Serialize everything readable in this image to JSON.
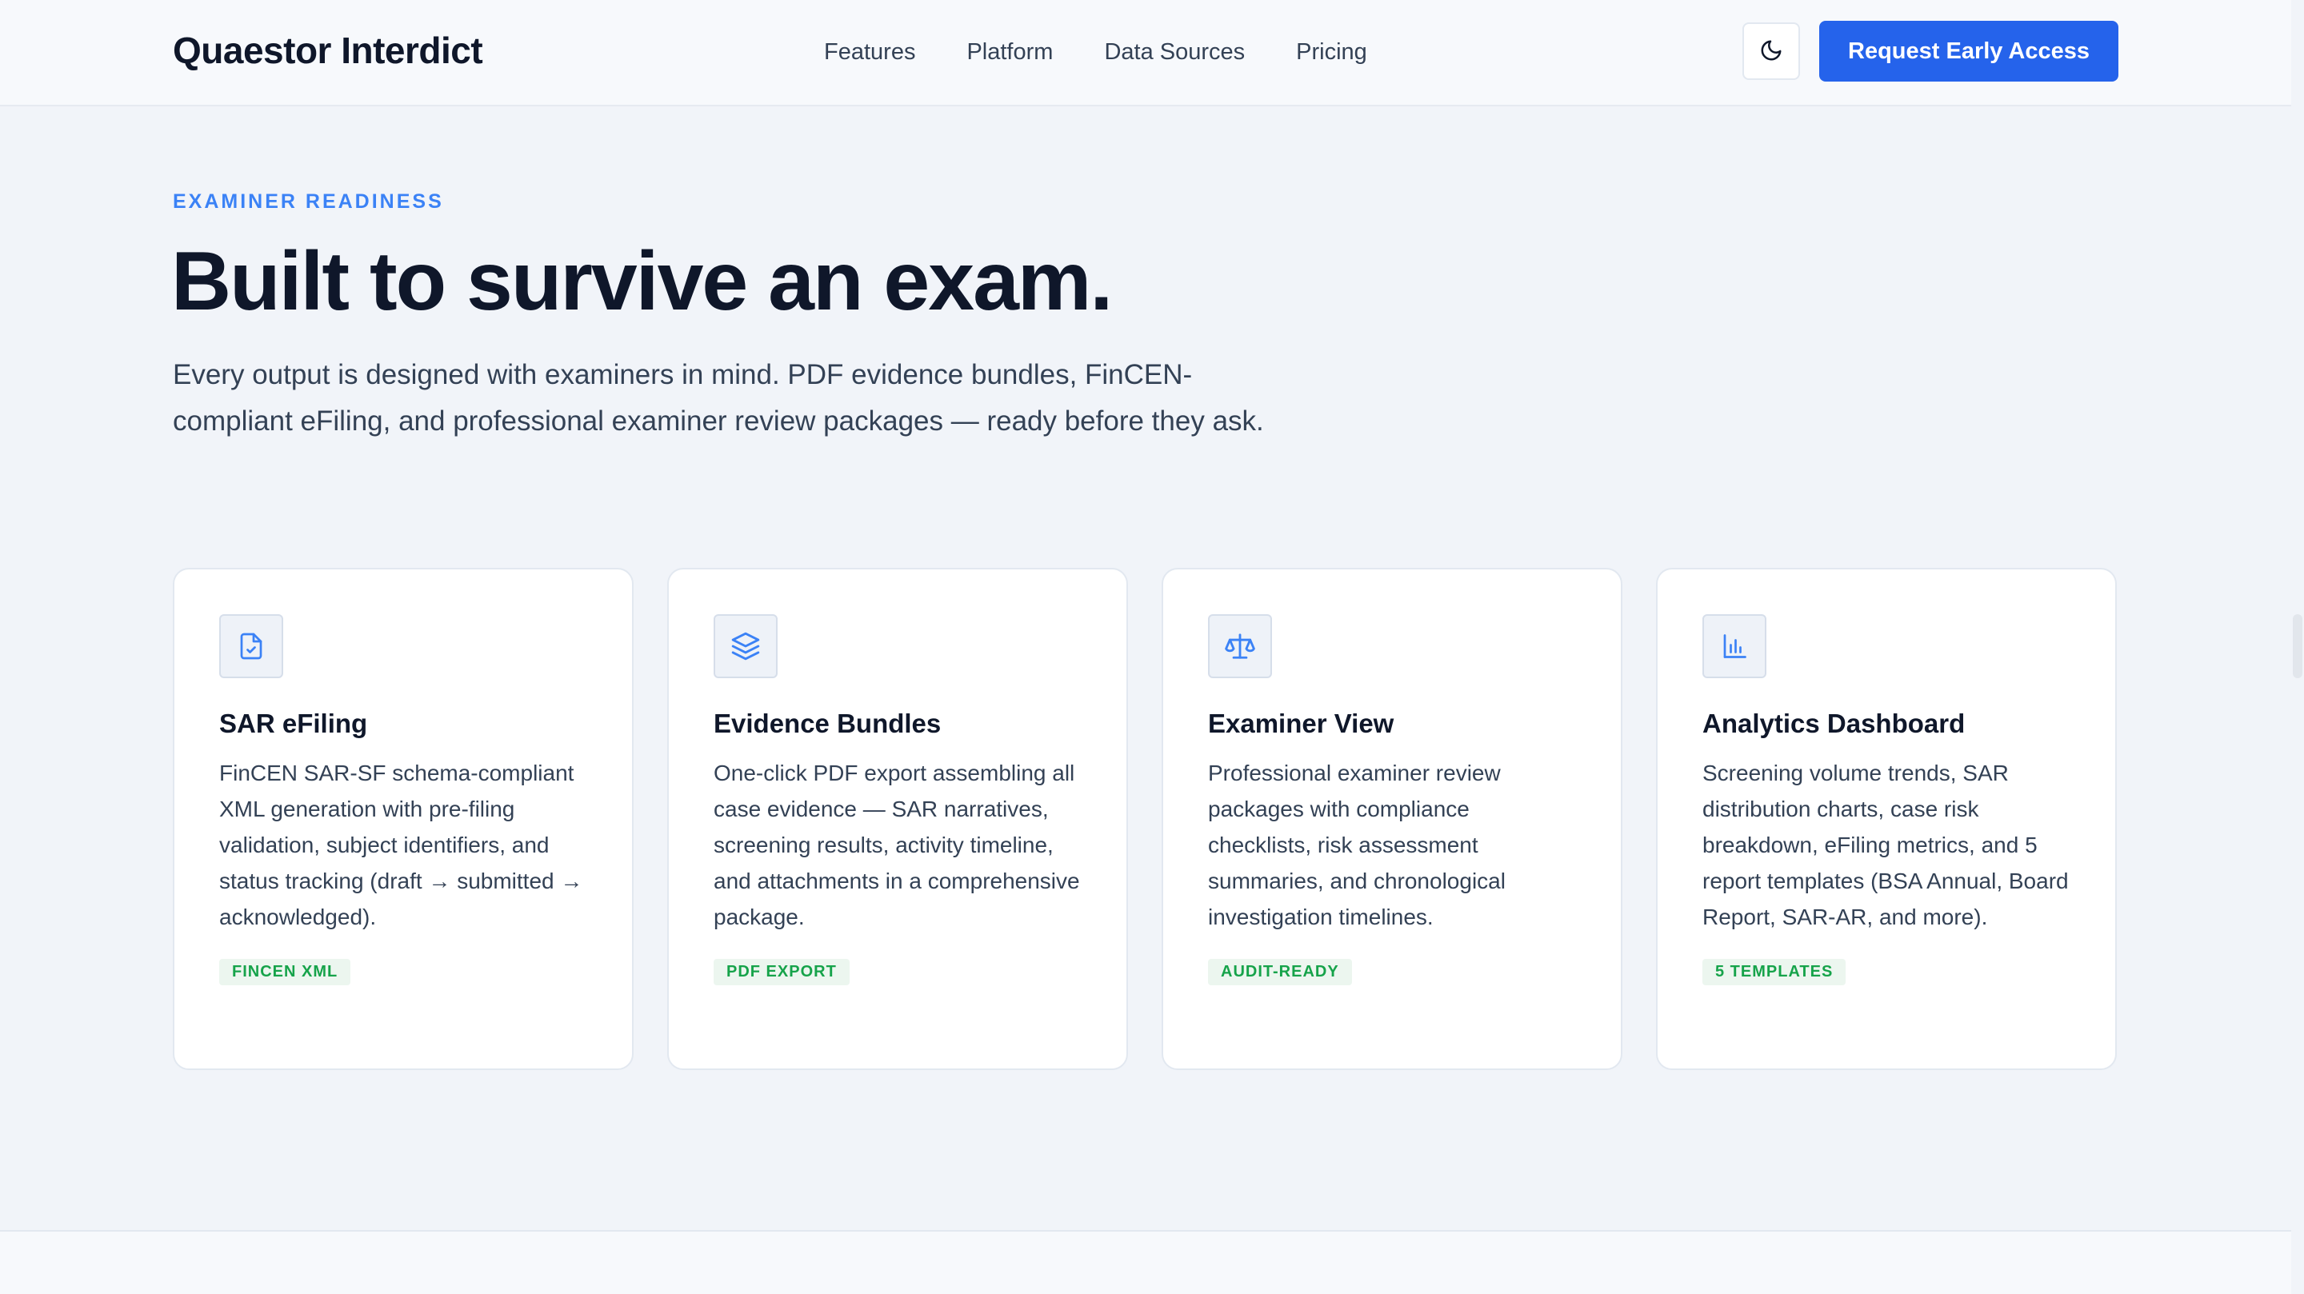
{
  "header": {
    "brand": "Quaestor Interdict",
    "nav": [
      "Features",
      "Platform",
      "Data Sources",
      "Pricing"
    ],
    "theme_toggle_icon": "moon-icon",
    "cta_label": "Request Early Access"
  },
  "hero": {
    "eyebrow": "EXAMINER READINESS",
    "title": "Built to survive an exam.",
    "lead": "Every output is designed with examiners in mind. PDF evidence bundles, FinCEN-compliant eFiling, and professional examiner review packages — ready before they ask."
  },
  "cards": [
    {
      "icon": "file-check-icon",
      "title": "SAR eFiling",
      "description": "FinCEN SAR-SF schema-compliant XML generation with pre-filing validation, subject identifiers, and status tracking (draft → submitted → acknowledged).",
      "badge": "FINCEN XML"
    },
    {
      "icon": "layers-icon",
      "title": "Evidence Bundles",
      "description": "One-click PDF export assembling all case evidence — SAR narratives, screening results, activity timeline, and attachments in a comprehensive package.",
      "badge": "PDF EXPORT"
    },
    {
      "icon": "scale-icon",
      "title": "Examiner View",
      "description": "Professional examiner review packages with compliance checklists, risk assessment summaries, and chronological investigation timelines.",
      "badge": "AUDIT-READY"
    },
    {
      "icon": "bar-chart-icon",
      "title": "Analytics Dashboard",
      "description": "Screening volume trends, SAR distribution charts, case risk breakdown, eFiling metrics, and 5 report templates (BSA Annual, Board Report, SAR-AR, and more).",
      "badge": "5 TEMPLATES"
    }
  ],
  "colors": {
    "accent": "#2563eb",
    "eyebrow": "#3b82f6",
    "badge_text": "#16a34a",
    "badge_bg": "#ecf6ef",
    "page_bg": "#f1f4f9"
  }
}
